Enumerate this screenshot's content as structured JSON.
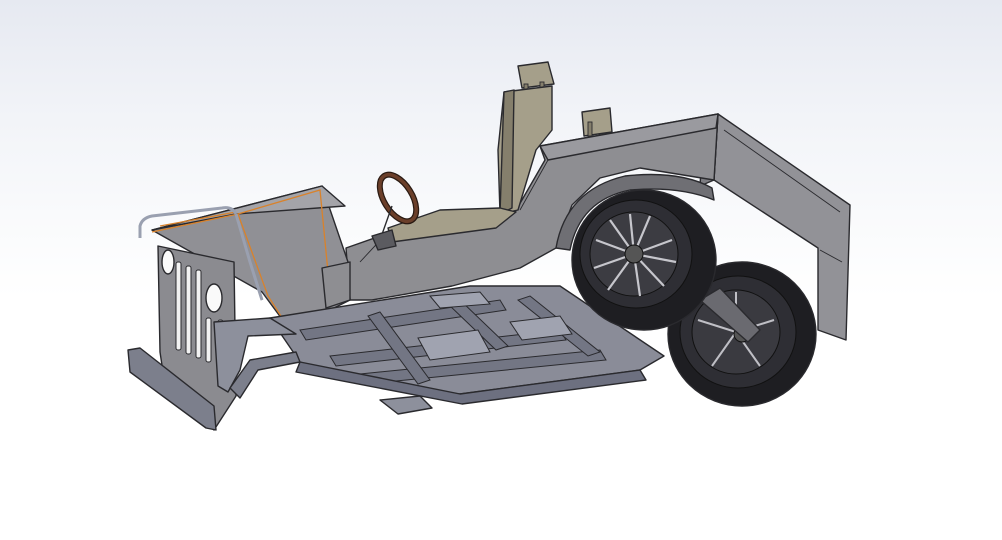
{
  "viewport": {
    "background_top": "#e6e9f1",
    "background_bottom": "#ffffff"
  },
  "model": {
    "body_color": "#8e8e92",
    "body_dark": "#6f6f74",
    "frame_color": "#8a8c98",
    "seat_color": "#a59f8a",
    "seat_dark": "#857f6c",
    "tire_color": "#1e1e22",
    "rim_color": "#3a3a40",
    "steering_wheel_color": "#6b3f2a",
    "selection_edge_color": "#d9822b"
  }
}
